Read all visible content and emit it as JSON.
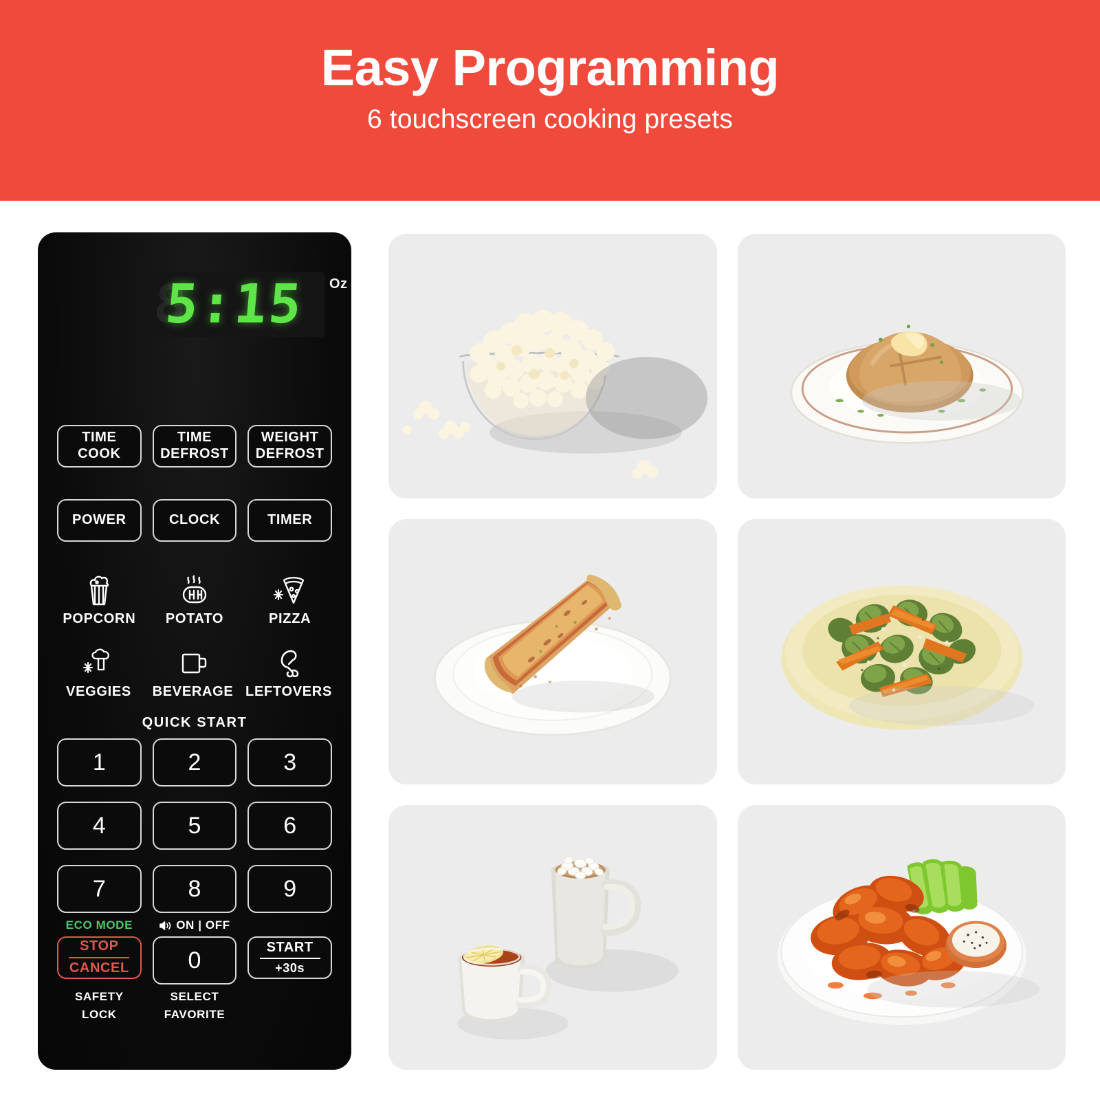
{
  "header": {
    "title": "Easy Programming",
    "subtitle": "6 touchscreen cooking presets",
    "bg_color": "#ef4a3c",
    "text_color": "#ffffff"
  },
  "control_panel": {
    "display": {
      "value": "5:15",
      "ghost_value": "8",
      "unit_label": "Oz",
      "led_color": "#5ee648",
      "panel_color": "#0d0d0d"
    },
    "function_row_1": [
      {
        "line1": "TIME",
        "line2": "COOK"
      },
      {
        "line1": "TIME",
        "line2": "DEFROST"
      },
      {
        "line1": "WEIGHT",
        "line2": "DEFROST"
      }
    ],
    "function_row_2": [
      {
        "line1": "POWER"
      },
      {
        "line1": "CLOCK"
      },
      {
        "line1": "TIMER"
      }
    ],
    "presets": [
      {
        "label": "POPCORN",
        "icon": "popcorn-icon"
      },
      {
        "label": "POTATO",
        "icon": "potato-icon"
      },
      {
        "label": "PIZZA",
        "icon": "pizza-icon"
      },
      {
        "label": "VEGGIES",
        "icon": "broccoli-icon"
      },
      {
        "label": "BEVERAGE",
        "icon": "mug-icon"
      },
      {
        "label": "LEFTOVERS",
        "icon": "drumstick-icon"
      }
    ],
    "quick_start_label": "QUICK START",
    "keypad": [
      "1",
      "2",
      "3",
      "4",
      "5",
      "6",
      "7",
      "8",
      "9"
    ],
    "mini_labels": {
      "eco": "ECO MODE",
      "eco_color": "#4cc86a",
      "sound_icon": "speaker-icon",
      "sound": "ON | OFF"
    },
    "bottom_row": {
      "stop_line1": "STOP",
      "stop_line2": "CANCEL",
      "stop_color": "#e0574b",
      "zero": "0",
      "start_line1": "START",
      "start_line2": "+30s"
    },
    "bottom_captions": [
      {
        "line1": "SAFETY",
        "line2": "LOCK"
      },
      {
        "line1": "SELECT",
        "line2": "FAVORITE"
      }
    ]
  },
  "gallery": {
    "tile_bg": "#ececec",
    "tiles": [
      {
        "name": "popcorn-photo",
        "alt": "Glass bowl of buttered popcorn with scattered kernels"
      },
      {
        "name": "potato-photo",
        "alt": "Baked potato with butter and chives on a rimmed plate"
      },
      {
        "name": "pizza-photo",
        "alt": "Slice of cheese pizza on a white paper plate"
      },
      {
        "name": "veggies-photo",
        "alt": "Roasted brussels sprouts and carrots on a cream plate"
      },
      {
        "name": "beverage-photo",
        "alt": "Hot cocoa mug with marshmallows and a cup of tea with lemon"
      },
      {
        "name": "leftovers-photo",
        "alt": "Buffalo wings with celery sticks and ranch dip"
      }
    ]
  }
}
